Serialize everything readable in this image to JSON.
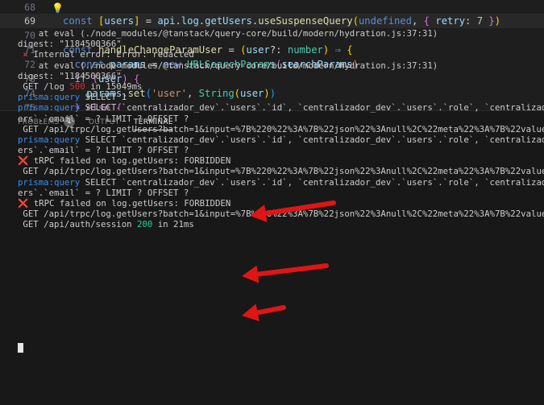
{
  "editor": {
    "lines": [
      {
        "num": "68",
        "tokens": []
      },
      {
        "num": "69",
        "current": true,
        "tokens": [
          {
            "t": "const ",
            "c": "kw"
          },
          {
            "t": "[",
            "c": "br"
          },
          {
            "t": "users",
            "c": "id"
          },
          {
            "t": "]",
            "c": "br"
          },
          {
            "t": " = ",
            "c": "p"
          },
          {
            "t": "api",
            "c": "id"
          },
          {
            "t": ".",
            "c": "p"
          },
          {
            "t": "log",
            "c": "id"
          },
          {
            "t": ".",
            "c": "p"
          },
          {
            "t": "getUsers",
            "c": "id"
          },
          {
            "t": ".",
            "c": "p"
          },
          {
            "t": "useSuspenseQuery",
            "c": "fn"
          },
          {
            "t": "(",
            "c": "br"
          },
          {
            "t": "undefined",
            "c": "kw"
          },
          {
            "t": ", ",
            "c": "p"
          },
          {
            "t": "{",
            "c": "br2"
          },
          {
            "t": " retry",
            "c": "id"
          },
          {
            "t": ": ",
            "c": "p"
          },
          {
            "t": "7",
            "c": "num"
          },
          {
            "t": " }",
            "c": "br2"
          },
          {
            "t": ")",
            "c": "br"
          }
        ]
      },
      {
        "num": "70",
        "tokens": []
      },
      {
        "num": "71",
        "tokens": [
          {
            "t": "const ",
            "c": "kw"
          },
          {
            "t": "handleChangeParamUser",
            "c": "fn"
          },
          {
            "t": " = ",
            "c": "p"
          },
          {
            "t": "(",
            "c": "br"
          },
          {
            "t": "user",
            "c": "id"
          },
          {
            "t": "?: ",
            "c": "p"
          },
          {
            "t": "number",
            "c": "ty"
          },
          {
            "t": ")",
            "c": "br"
          },
          {
            "t": " ⇒ ",
            "c": "kw"
          },
          {
            "t": "{",
            "c": "br"
          }
        ]
      },
      {
        "num": "72",
        "indent": 1,
        "tokens": [
          {
            "t": "const ",
            "c": "kw"
          },
          {
            "t": "params",
            "c": "id"
          },
          {
            "t": " = ",
            "c": "p"
          },
          {
            "t": "new ",
            "c": "kw"
          },
          {
            "t": "URLSearchParams",
            "c": "ty"
          },
          {
            "t": "(",
            "c": "br2"
          },
          {
            "t": "searchParams",
            "c": "id"
          },
          {
            "t": ")",
            "c": "br2"
          }
        ]
      },
      {
        "num": "73",
        "indent": 1,
        "tokens": [
          {
            "t": "if ",
            "c": "kw2"
          },
          {
            "t": "(",
            "c": "br2"
          },
          {
            "t": "user",
            "c": "id"
          },
          {
            "t": ")",
            "c": "br2"
          },
          {
            "t": " {",
            "c": "br2"
          }
        ]
      },
      {
        "num": "74",
        "indent": 2,
        "tokens": [
          {
            "t": "params",
            "c": "id"
          },
          {
            "t": ".",
            "c": "p"
          },
          {
            "t": "set",
            "c": "fn"
          },
          {
            "t": "(",
            "c": "br3"
          },
          {
            "t": "'user'",
            "c": "str"
          },
          {
            "t": ", ",
            "c": "p"
          },
          {
            "t": "String",
            "c": "ty"
          },
          {
            "t": "(",
            "c": "br"
          },
          {
            "t": "user",
            "c": "id"
          },
          {
            "t": ")",
            "c": "br"
          },
          {
            "t": ")",
            "c": "br3"
          }
        ]
      },
      {
        "num": "75",
        "indent": 1,
        "tokens": [
          {
            "t": "} ",
            "c": "br2"
          },
          {
            "t": "else ",
            "c": "kw2"
          },
          {
            "t": "{",
            "c": "br2"
          }
        ]
      }
    ]
  },
  "panel": {
    "tabs": [
      {
        "label": "PROBLEMS",
        "active": false
      },
      {
        "label": "OUTPUT",
        "active": false
      },
      {
        "label": "TERMINAL",
        "active": true
      }
    ],
    "problems_count": "1"
  },
  "terminal": {
    "lines": [
      [
        {
          "t": "    at eval (./node_modules/@tanstack/query-core/build/modern/hydration.js:37:31)"
        }
      ],
      [
        {
          "t": "digest: \"1184500366\""
        }
      ],
      [
        {
          "t": " × ",
          "c": "red"
        },
        {
          "t": "Internal error: Error: redacted"
        }
      ],
      [
        {
          "t": "    at eval (./node_modules/@tanstack/query-core/build/modern/hydration.js:37:31)"
        }
      ],
      [
        {
          "t": "digest: \"1184500366\""
        }
      ],
      [
        {
          "t": " GET /log "
        },
        {
          "t": "500",
          "c": "err"
        },
        {
          "t": " in 15049ms"
        }
      ],
      [
        {
          "t": "prisma:query",
          "c": "prisma"
        },
        {
          "t": " SELECT 1"
        }
      ],
      [
        {
          "t": "prisma:query",
          "c": "prisma"
        },
        {
          "t": " SELECT `centralizador_dev`.`users`.`id`, `centralizador_dev`.`users`.`role`, `centralizador_dev`"
        }
      ],
      [
        {
          "t": "ers`.`email` = ? LIMIT ? OFFSET ?"
        }
      ],
      [
        {
          "t": " GET /api/trpc/log.getUsers?batch=1&input=%7B%220%22%3A%7B%22json%22%3Anull%2C%22meta%22%3A%7B%22values"
        }
      ],
      [
        {
          "t": "prisma:query",
          "c": "prisma"
        },
        {
          "t": " SELECT `centralizador_dev`.`users`.`id`, `centralizador_dev`.`users`.`role`, `centralizador_dev`"
        }
      ],
      [
        {
          "t": "ers`.`email` = ? LIMIT ? OFFSET ?"
        }
      ],
      [
        {
          "t": "❌ ",
          "c": "red"
        },
        {
          "t": "tRPC failed on log.getUsers: FORBIDDEN"
        }
      ],
      [
        {
          "t": " GET /api/trpc/log.getUsers?batch=1&input=%7B%220%22%3A%7B%22json%22%3Anull%2C%22meta%22%3A%7B%22values"
        }
      ],
      [
        {
          "t": "prisma:query",
          "c": "prisma"
        },
        {
          "t": " SELECT `centralizador_dev`.`users`.`id`, `centralizador_dev`.`users`.`role`, `centralizador_dev`"
        }
      ],
      [
        {
          "t": "ers`.`email` = ? LIMIT ? OFFSET ?"
        }
      ],
      [
        {
          "t": "❌ ",
          "c": "red"
        },
        {
          "t": "tRPC failed on log.getUsers: FORBIDDEN"
        }
      ],
      [
        {
          "t": " GET /api/trpc/log.getUsers?batch=1&input=%7B%220%22%3A%7B%22json%22%3Anull%2C%22meta%22%3A%7B%22values"
        }
      ],
      [
        {
          "t": " GET /api/auth/session "
        },
        {
          "t": "200",
          "c": "status"
        },
        {
          "t": " in 21ms"
        }
      ]
    ]
  },
  "colors": {
    "arrow": "#e01515"
  }
}
